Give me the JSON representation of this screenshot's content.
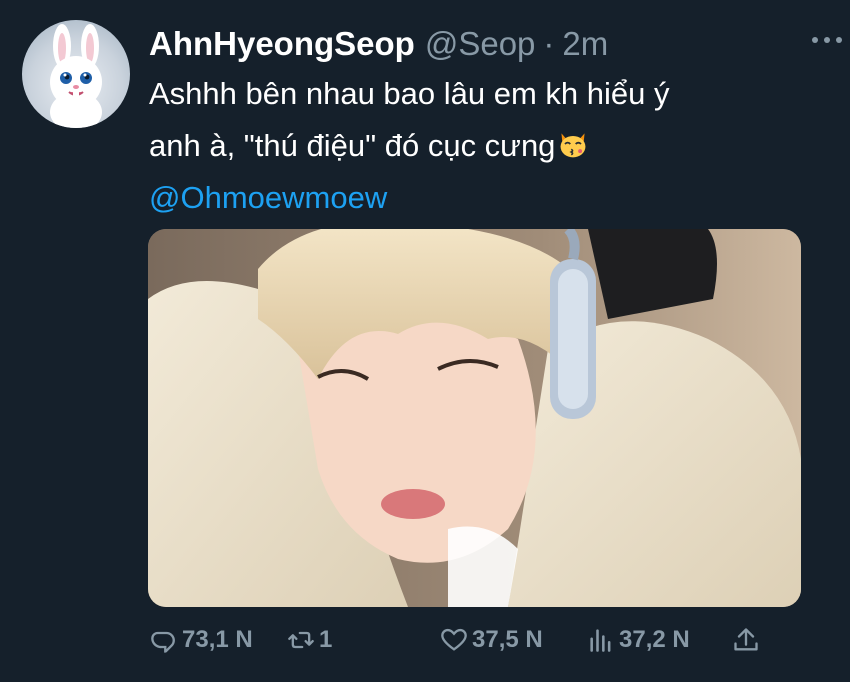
{
  "tweet": {
    "author": {
      "display_name": "AhnHyeongSeop",
      "handle": "@Seop",
      "separator": "·",
      "time": "2m"
    },
    "text_line1": "Ashhh bên nhau bao lâu em kh hiểu ý",
    "text_line2": "anh à, \"thú điệu\" đó cục cưng",
    "emoji": "kissing-cat-emoji",
    "mention": "@Ohmoewmoew",
    "stats": {
      "replies": "73,1 N",
      "retweets": "1",
      "likes": "37,5 N",
      "views": "37,2 N"
    }
  },
  "icons": {
    "more": "more-horizontal-icon",
    "reply": "reply-icon",
    "retweet": "retweet-icon",
    "like": "heart-icon",
    "views": "analytics-icon",
    "share": "share-icon"
  },
  "colors": {
    "background": "#15202b",
    "text": "#ffffff",
    "secondary": "#8899a6",
    "link": "#1da1f2"
  }
}
